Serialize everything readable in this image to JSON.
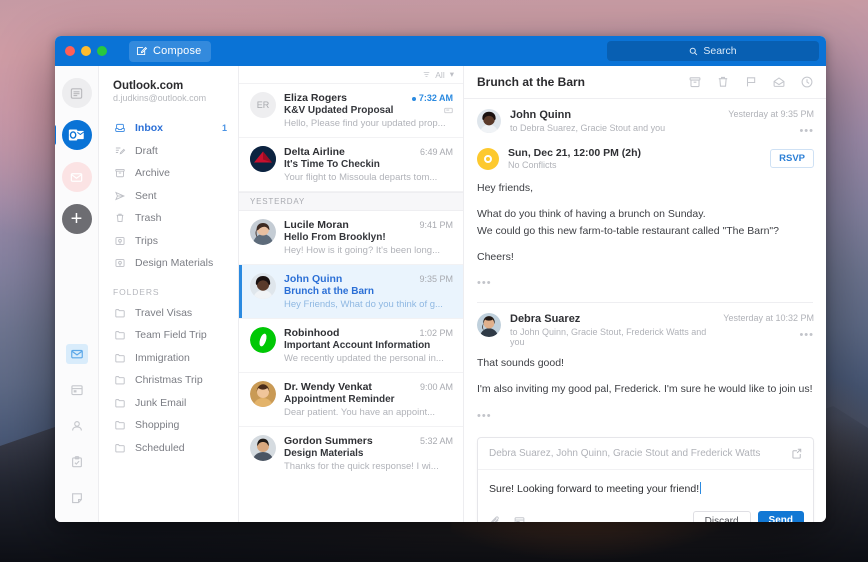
{
  "titlebar": {
    "compose_label": "Compose",
    "search_placeholder": "Search",
    "accent": "#0a73d6"
  },
  "rail": {
    "accounts": [
      {
        "name": "account-generic",
        "initials": ""
      },
      {
        "name": "account-outlook",
        "initials": ""
      },
      {
        "name": "account-mail",
        "initials": ""
      },
      {
        "name": "add-account",
        "initials": "+"
      }
    ],
    "modules": [
      "mail-icon",
      "calendar-icon",
      "people-icon",
      "tasks-icon",
      "notes-icon"
    ]
  },
  "sidebar": {
    "account_name": "Outlook.com",
    "account_email": "d.judkins@outlook.com",
    "items": [
      {
        "label": "Inbox",
        "icon": "inbox-icon",
        "badge": "1",
        "active": true
      },
      {
        "label": "Draft",
        "icon": "draft-icon",
        "badge": "",
        "active": false
      },
      {
        "label": "Archive",
        "icon": "archive-icon",
        "badge": "",
        "active": false
      },
      {
        "label": "Sent",
        "icon": "sent-icon",
        "badge": "",
        "active": false
      },
      {
        "label": "Trash",
        "icon": "trash-icon",
        "badge": "",
        "active": false
      },
      {
        "label": "Trips",
        "icon": "trips-icon",
        "badge": "",
        "active": false
      },
      {
        "label": "Design Materials",
        "icon": "trips-icon",
        "badge": "",
        "active": false
      }
    ],
    "folders_header": "FOLDERS",
    "folders": [
      {
        "label": "Travel Visas",
        "icon": "folder-icon"
      },
      {
        "label": "Team Field Trip",
        "icon": "folder-icon"
      },
      {
        "label": "Immigration",
        "icon": "folder-icon"
      },
      {
        "label": "Christmas Trip",
        "icon": "folder-icon"
      },
      {
        "label": "Junk Email",
        "icon": "folder-icon"
      },
      {
        "label": "Shopping",
        "icon": "folder-icon"
      },
      {
        "label": "Scheduled",
        "icon": "folder-icon"
      }
    ]
  },
  "message_list": {
    "filter_label": "All",
    "day_separator": "YESTERDAY",
    "messages": [
      {
        "from": "Eliza Rogers",
        "subject": "K&V Updated Proposal",
        "preview": "Hello, Please find your updated prop...",
        "time": "7:32 AM",
        "unread": true,
        "selected": false,
        "has_attachment": true,
        "avatar_type": "initials",
        "initials": "ER"
      },
      {
        "from": "Delta Airline",
        "subject": "It's Time To Checkin",
        "preview": "Your flight to Missoula departs tom...",
        "time": "6:49 AM",
        "unread": false,
        "selected": false,
        "has_attachment": false,
        "avatar_type": "delta",
        "initials": ""
      },
      {
        "from": "Lucile Moran",
        "subject": "Hello From Brooklyn!",
        "preview": "Hey! How is it going?  It's been long...",
        "time": "9:41 PM",
        "unread": false,
        "selected": false,
        "has_attachment": false,
        "avatar_type": "photo-woman1",
        "initials": ""
      },
      {
        "from": "John Quinn",
        "subject": "Brunch at the Barn",
        "preview": "Hey Friends, What do you think of g...",
        "time": "9:35 PM",
        "unread": false,
        "selected": true,
        "has_attachment": false,
        "avatar_type": "photo-man1",
        "initials": ""
      },
      {
        "from": "Robinhood",
        "subject": "Important Account Information",
        "preview": "We recently updated the personal in...",
        "time": "1:02 PM",
        "unread": false,
        "selected": false,
        "has_attachment": false,
        "avatar_type": "robinhood",
        "initials": ""
      },
      {
        "from": "Dr. Wendy Venkat",
        "subject": "Appointment Reminder",
        "preview": "Dear patient. You have an appoint...",
        "time": "9:00 AM",
        "unread": false,
        "selected": false,
        "has_attachment": false,
        "avatar_type": "photo-woman2",
        "initials": ""
      },
      {
        "from": "Gordon Summers",
        "subject": "Design Materials",
        "preview": "Thanks for the quick response! I wi...",
        "time": "5:32 AM",
        "unread": false,
        "selected": false,
        "has_attachment": false,
        "avatar_type": "photo-man2",
        "initials": ""
      }
    ]
  },
  "reading_pane": {
    "subject": "Brunch at the Barn",
    "actions": [
      "archive-icon",
      "trash-icon",
      "flag-icon",
      "mark-unread-icon",
      "snooze-icon"
    ],
    "event": {
      "when": "Sun, Dec 21, 12:00 PM (2h)",
      "conflicts": "No Conflicts",
      "rsvp_label": "RSVP"
    },
    "messages": [
      {
        "sender": "John Quinn",
        "recipients": "to Debra Suarez, Gracie Stout and you",
        "time": "Yesterday at 9:35 PM",
        "avatar_type": "photo-man1",
        "paragraphs": [
          "Hey friends,",
          "What do you think of having a brunch on Sunday.\nWe could go this new farm-to-table restaurant called \"The Barn\"?",
          "Cheers!"
        ]
      },
      {
        "sender": "Debra Suarez",
        "recipients": "to John Quinn, Gracie Stout, Frederick Watts and you",
        "time": "Yesterday at 10:32 PM",
        "avatar_type": "photo-woman3",
        "paragraphs": [
          "That sounds good!",
          "I'm also inviting my good pal, Frederick. I'm sure he would like to join us!"
        ]
      }
    ]
  },
  "reply_box": {
    "recipients": "Debra Suarez, John Quinn, Gracie Stout and Frederick Watts",
    "body": "Sure! Looking forward to meeting your friend!",
    "expand_icon": "popout-icon",
    "attach_icon": "paperclip-icon",
    "insert_icon": "insert-image-icon",
    "discard_label": "Discard",
    "send_label": "Send",
    "send_color": "#1278d4"
  }
}
